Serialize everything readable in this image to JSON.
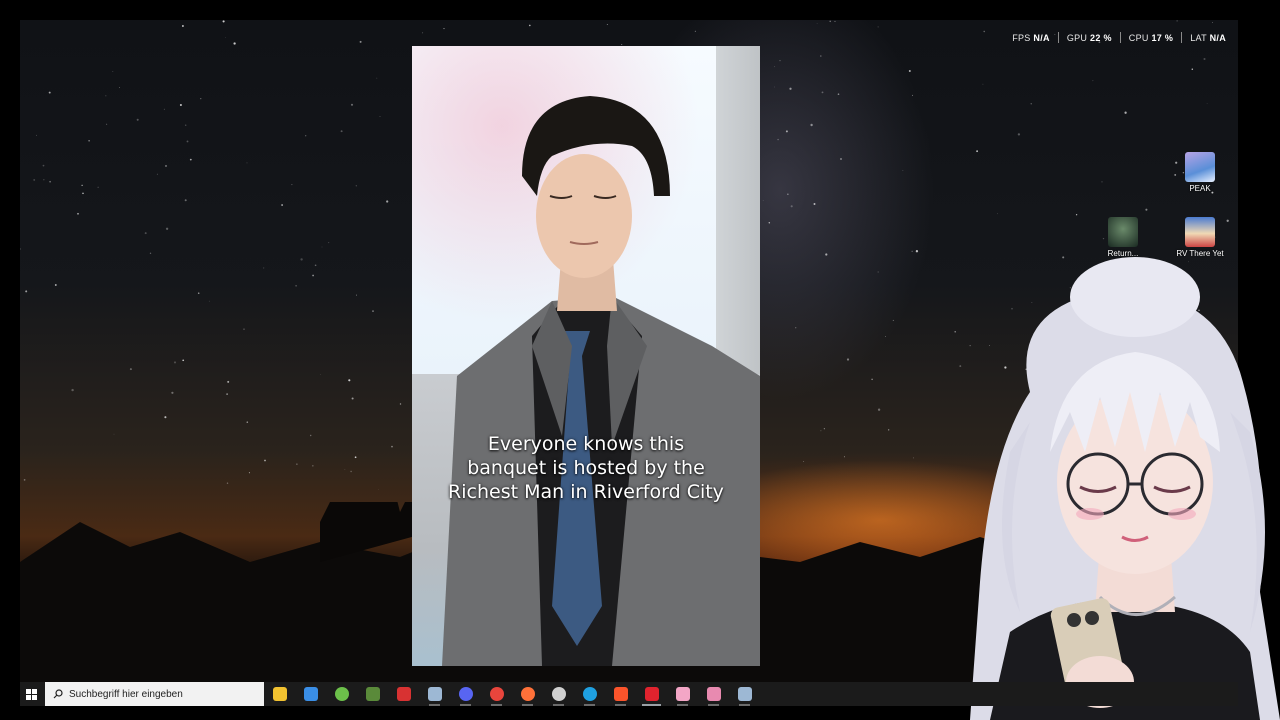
{
  "overlay": {
    "fps_label": "FPS",
    "fps_value": "N/A",
    "gpu_label": "GPU",
    "gpu_value": "22 %",
    "cpu_label": "CPU",
    "cpu_value": "17 %",
    "lat_label": "LAT",
    "lat_value": "N/A"
  },
  "desktop_icons": [
    {
      "label": "PEAK",
      "icon": "peak-game-icon"
    },
    {
      "label": "Return...",
      "icon": "return-game-icon"
    },
    {
      "label": "RV There Yet",
      "icon": "rv-there-yet-icon"
    }
  ],
  "video": {
    "caption_lines": [
      "Everyone knows this",
      "banquet is hosted by the",
      "Richest Man in Riverford City"
    ]
  },
  "taskbar": {
    "search_placeholder": "Suchbegriff hier eingeben",
    "apps": [
      {
        "name": "file-explorer-icon",
        "color": "#f2c230"
      },
      {
        "name": "store-icon",
        "color": "#3a8ee6"
      },
      {
        "name": "android-app-icon",
        "color": "#6cc04a"
      },
      {
        "name": "minecraft-icon",
        "color": "#5a8a3a"
      },
      {
        "name": "badge-app-icon",
        "color": "#d83232"
      },
      {
        "name": "steam-icon",
        "color": "#9db8d4"
      },
      {
        "name": "discord-icon",
        "color": "#5865f2"
      },
      {
        "name": "chrome-icon",
        "color": "#e8453c"
      },
      {
        "name": "firefox-icon",
        "color": "#ff7139"
      },
      {
        "name": "obs-icon",
        "color": "#d0d0d0"
      },
      {
        "name": "edge-icon",
        "color": "#1fa0e0"
      },
      {
        "name": "brave-icon",
        "color": "#fb542b"
      },
      {
        "name": "opera-icon",
        "color": "#e0232e"
      },
      {
        "name": "pink-app-icon",
        "color": "#f3a6c6"
      },
      {
        "name": "controller-app-icon",
        "color": "#e88ab0"
      },
      {
        "name": "steam-icon-2",
        "color": "#9db8d4"
      }
    ]
  }
}
